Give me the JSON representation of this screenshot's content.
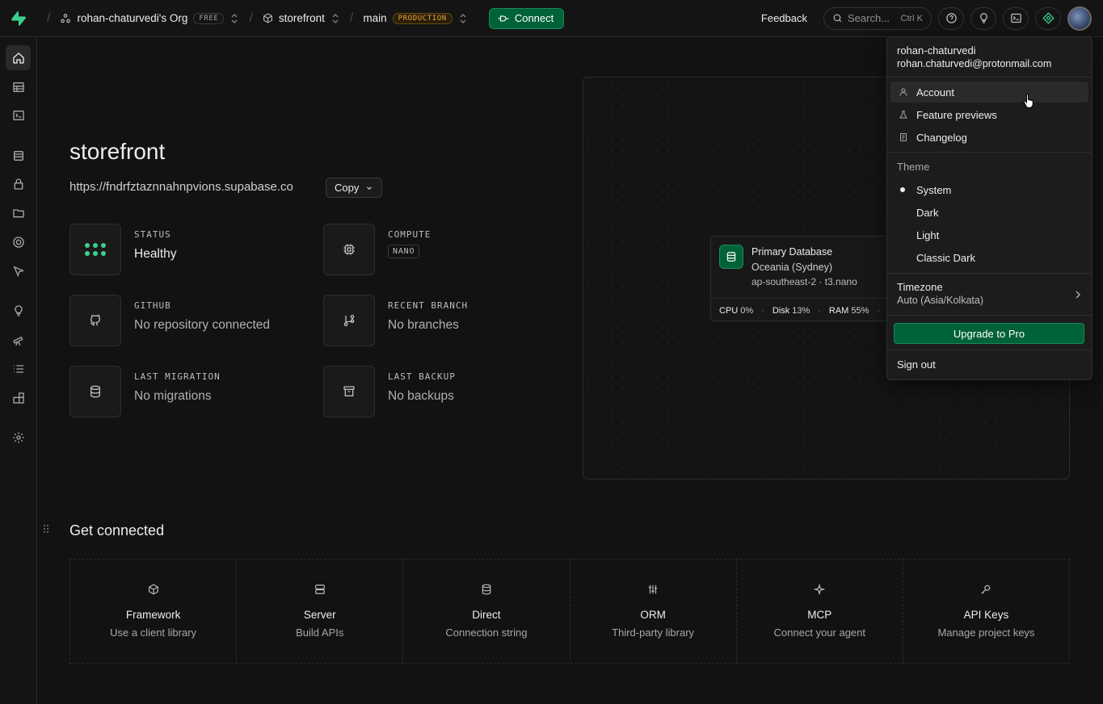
{
  "topbar": {
    "org_name": "rohan-chaturvedi's Org",
    "org_plan": "FREE",
    "project_name": "storefront",
    "branch_name": "main",
    "branch_env": "PRODUCTION",
    "connect_label": "Connect",
    "feedback_label": "Feedback",
    "search_placeholder": "Search...",
    "search_shortcut": "Ctrl K"
  },
  "project": {
    "title": "storefront",
    "url": "https://fndrfztaznnahnpvions.supabase.co",
    "copy_label": "Copy"
  },
  "stats": {
    "status": {
      "label": "STATUS",
      "value": "Healthy"
    },
    "compute": {
      "label": "COMPUTE",
      "value": "NANO"
    },
    "github": {
      "label": "GITHUB",
      "value": "No repository connected"
    },
    "recent_branch": {
      "label": "RECENT BRANCH",
      "value": "No branches"
    },
    "last_migration": {
      "label": "LAST MIGRATION",
      "value": "No migrations"
    },
    "last_backup": {
      "label": "LAST BACKUP",
      "value": "No backups"
    }
  },
  "database": {
    "name": "Primary Database",
    "region": "Oceania (Sydney)",
    "detail": "ap-southeast-2 · t3.nano",
    "cpu_label": "CPU",
    "cpu": "0%",
    "disk_label": "Disk",
    "disk": "13%",
    "ram_label": "RAM",
    "ram": "55%"
  },
  "get_connected": {
    "title": "Get connected",
    "cards": [
      {
        "name": "Framework",
        "desc": "Use a client library",
        "icon": "cube-icon"
      },
      {
        "name": "Server",
        "desc": "Build APIs",
        "icon": "server-icon"
      },
      {
        "name": "Direct",
        "desc": "Connection string",
        "icon": "database-icon"
      },
      {
        "name": "ORM",
        "desc": "Third-party library",
        "icon": "orm-icon"
      },
      {
        "name": "MCP",
        "desc": "Connect your agent",
        "icon": "sparkle-icon"
      },
      {
        "name": "API Keys",
        "desc": "Manage project keys",
        "icon": "key-icon"
      }
    ]
  },
  "user_menu": {
    "username": "rohan-chaturvedi",
    "email": "rohan.chaturvedi@protonmail.com",
    "items": [
      {
        "label": "Account",
        "icon": "user-icon"
      },
      {
        "label": "Feature previews",
        "icon": "flask-icon"
      },
      {
        "label": "Changelog",
        "icon": "changelog-icon"
      }
    ],
    "theme_label": "Theme",
    "themes": [
      "System",
      "Dark",
      "Light",
      "Classic Dark"
    ],
    "selected_theme": "System",
    "timezone_label": "Timezone",
    "timezone_value": "Auto (Asia/Kolkata)",
    "upgrade_label": "Upgrade to Pro",
    "signout_label": "Sign out"
  },
  "colors": {
    "accent": "#3ecf8e",
    "brand_button": "#006239",
    "warning": "#e8a33d",
    "background": "#121212"
  }
}
